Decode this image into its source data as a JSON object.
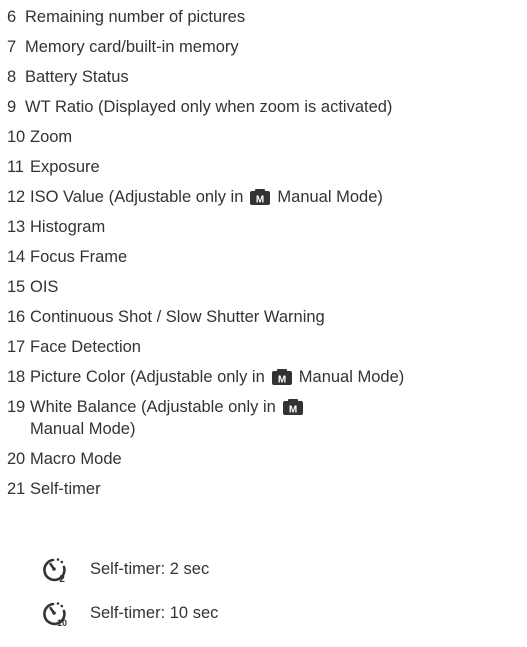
{
  "items": [
    {
      "num": "6",
      "text": "Remaining number of pictures"
    },
    {
      "num": "7",
      "text": "Memory card/built-in memory"
    },
    {
      "num": "8",
      "text": "Battery Status"
    },
    {
      "num": "9",
      "text": "WT Ratio (Displayed only when zoom is activated)"
    },
    {
      "num": "10",
      "text": "Zoom"
    },
    {
      "num": "11",
      "text": "Exposure"
    },
    {
      "num": "12",
      "text_before": "ISO Value (Adjustable only in",
      "text_after": "Manual Mode)",
      "icon": "manual-mode-icon"
    },
    {
      "num": "13",
      "text": "Histogram"
    },
    {
      "num": "14",
      "text": "Focus Frame"
    },
    {
      "num": "15",
      "text": "OIS"
    },
    {
      "num": "16",
      "text": "Continuous Shot / Slow Shutter Warning"
    },
    {
      "num": "17",
      "text": "Face Detection"
    },
    {
      "num": "18",
      "text_before": "Picture Color (Adjustable only in",
      "text_after": "Manual Mode)",
      "icon": "manual-mode-icon"
    },
    {
      "num": "19",
      "text_before": "White Balance (Adjustable only in",
      "text_after": "Manual Mode)",
      "icon": "manual-mode-icon"
    },
    {
      "num": "20",
      "text": "Macro Mode"
    },
    {
      "num": "21",
      "text": "Self-timer"
    }
  ],
  "sub_items": [
    {
      "icon": "self-timer-2-icon",
      "icon_digit": "2",
      "label": "Self-timer: 2 sec"
    },
    {
      "icon": "self-timer-10-icon",
      "icon_digit": "10",
      "label": "Self-timer: 10 sec"
    }
  ],
  "mode_icon_letter": "M",
  "colors": {
    "text": "#333333",
    "icon_fill": "#333333"
  }
}
